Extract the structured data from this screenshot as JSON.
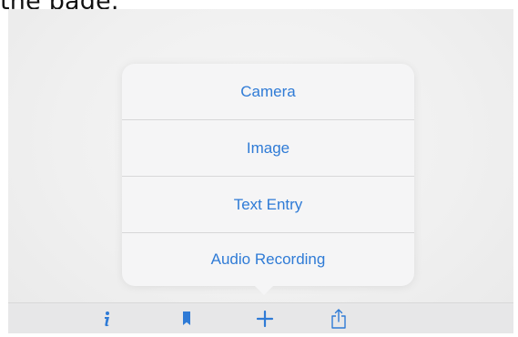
{
  "caption": "the page.",
  "menu": {
    "items": [
      {
        "label": "Camera"
      },
      {
        "label": "Image"
      },
      {
        "label": "Text Entry"
      },
      {
        "label": "Audio Recording"
      }
    ]
  },
  "toolbar": {
    "buttons": [
      {
        "icon": "info-icon"
      },
      {
        "icon": "bookmark-icon"
      },
      {
        "icon": "plus-icon"
      },
      {
        "icon": "share-icon"
      }
    ]
  },
  "colors": {
    "accent": "#2f7bd6",
    "background": "#f0f0f0",
    "popover": "#f5f5f6",
    "toolbar": "#e7e7e8"
  }
}
